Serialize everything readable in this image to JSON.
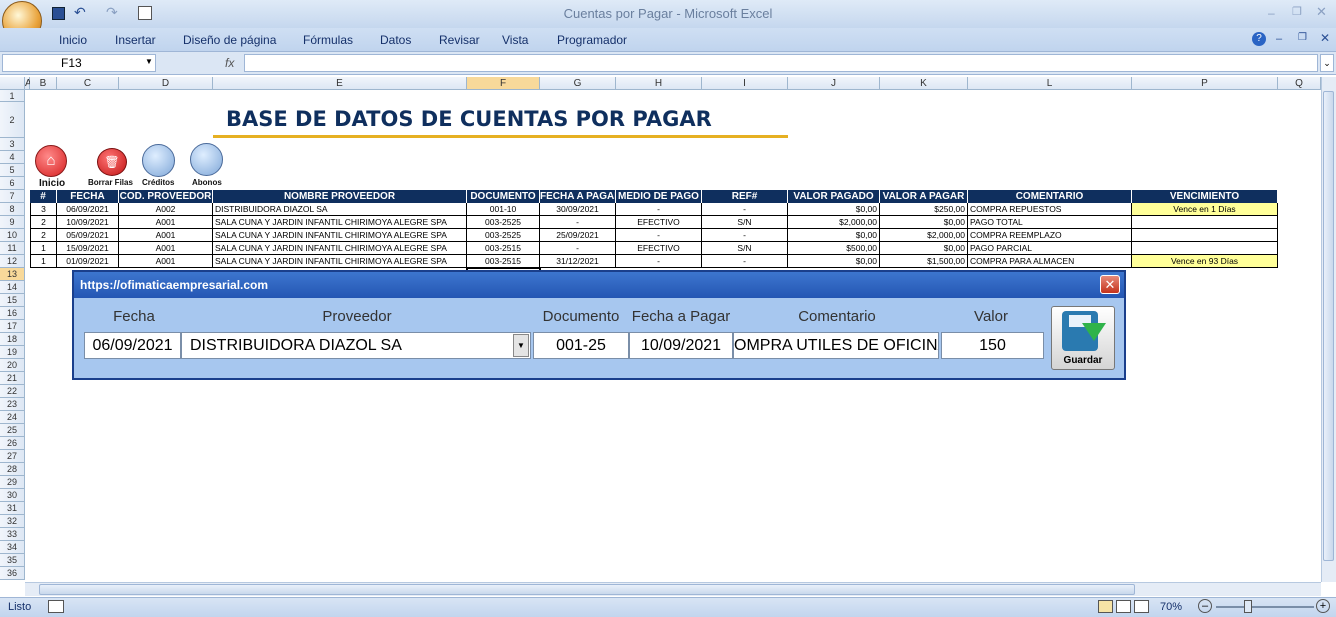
{
  "window": {
    "title": "Cuentas por Pagar - Microsoft Excel"
  },
  "ribbon": {
    "tabs": [
      "Inicio",
      "Insertar",
      "Diseño de página",
      "Fórmulas",
      "Datos",
      "Revisar",
      "Vista",
      "Programador"
    ]
  },
  "formula_bar": {
    "name_box": "F13",
    "fx": "fx",
    "value": ""
  },
  "columns": [
    "A",
    "B",
    "C",
    "D",
    "E",
    "F",
    "G",
    "H",
    "I",
    "J",
    "K",
    "L",
    "P",
    "Q"
  ],
  "rows": [
    "1",
    "2",
    "3",
    "4",
    "5",
    "6",
    "7",
    "8",
    "9",
    "10",
    "11",
    "12",
    "13",
    "14",
    "15",
    "16",
    "17",
    "18",
    "19",
    "20",
    "21",
    "22",
    "23",
    "24",
    "25",
    "26",
    "27",
    "28",
    "29",
    "30",
    "31",
    "32",
    "33",
    "34",
    "35",
    "36"
  ],
  "sheet": {
    "heading": "BASE DE DATOS DE CUENTAS POR PAGAR",
    "buttons": {
      "inicio": "Inicio",
      "borrar": "Borrar Filas",
      "creditos": "Créditos",
      "abonos": "Abonos"
    },
    "headers": [
      "#",
      "FECHA",
      "COD. PROVEEDOR",
      "NOMBRE PROVEEDOR",
      "DOCUMENTO",
      "FECHA A PAGAR",
      "MEDIO DE PAGO",
      "REF#",
      "VALOR PAGADO",
      "VALOR A PAGAR",
      "COMENTARIO",
      "VENCIMIENTO"
    ],
    "table": [
      [
        "3",
        "06/09/2021",
        "A002",
        "DISTRIBUIDORA DIAZOL SA",
        "001-10",
        "30/09/2021",
        "-",
        "-",
        "$0,00",
        "$250,00",
        "COMPRA REPUESTOS",
        "Vence en 1 Días"
      ],
      [
        "2",
        "10/09/2021",
        "A001",
        "SALA CUNA Y JARDIN INFANTIL CHIRIMOYA ALEGRE SPA",
        "003-2525",
        "-",
        "EFECTIVO",
        "S/N",
        "$2,000,00",
        "$0,00",
        "PAGO TOTAL",
        ""
      ],
      [
        "2",
        "05/09/2021",
        "A001",
        "SALA CUNA Y JARDIN INFANTIL CHIRIMOYA ALEGRE SPA",
        "003-2525",
        "25/09/2021",
        "-",
        "-",
        "$0,00",
        "$2,000,00",
        "COMPRA REEMPLAZO",
        ""
      ],
      [
        "1",
        "15/09/2021",
        "A001",
        "SALA CUNA Y JARDIN INFANTIL CHIRIMOYA ALEGRE SPA",
        "003-2515",
        "-",
        "EFECTIVO",
        "S/N",
        "$500,00",
        "$0,00",
        "PAGO PARCIAL",
        ""
      ],
      [
        "1",
        "01/09/2021",
        "A001",
        "SALA CUNA Y JARDIN INFANTIL CHIRIMOYA ALEGRE SPA",
        "003-2515",
        "31/12/2021",
        "-",
        "-",
        "$0,00",
        "$1,500,00",
        "COMPRA PARA ALMACEN",
        "Vence en 93 Días"
      ]
    ]
  },
  "dialog": {
    "title": "https://ofimaticaempresarial.com",
    "labels": {
      "fecha": "Fecha",
      "proveedor": "Proveedor",
      "documento": "Documento",
      "fecha_pagar": "Fecha a Pagar",
      "comentario": "Comentario",
      "valor": "Valor"
    },
    "values": {
      "fecha": "06/09/2021",
      "proveedor": "DISTRIBUIDORA DIAZOL SA",
      "documento": "001-25",
      "fecha_pagar": "10/09/2021",
      "comentario": "OMPRA UTILES DE OFICINA",
      "valor": "150"
    },
    "save_label": "Guardar"
  },
  "status": {
    "text": "Listo",
    "zoom": "70%"
  }
}
